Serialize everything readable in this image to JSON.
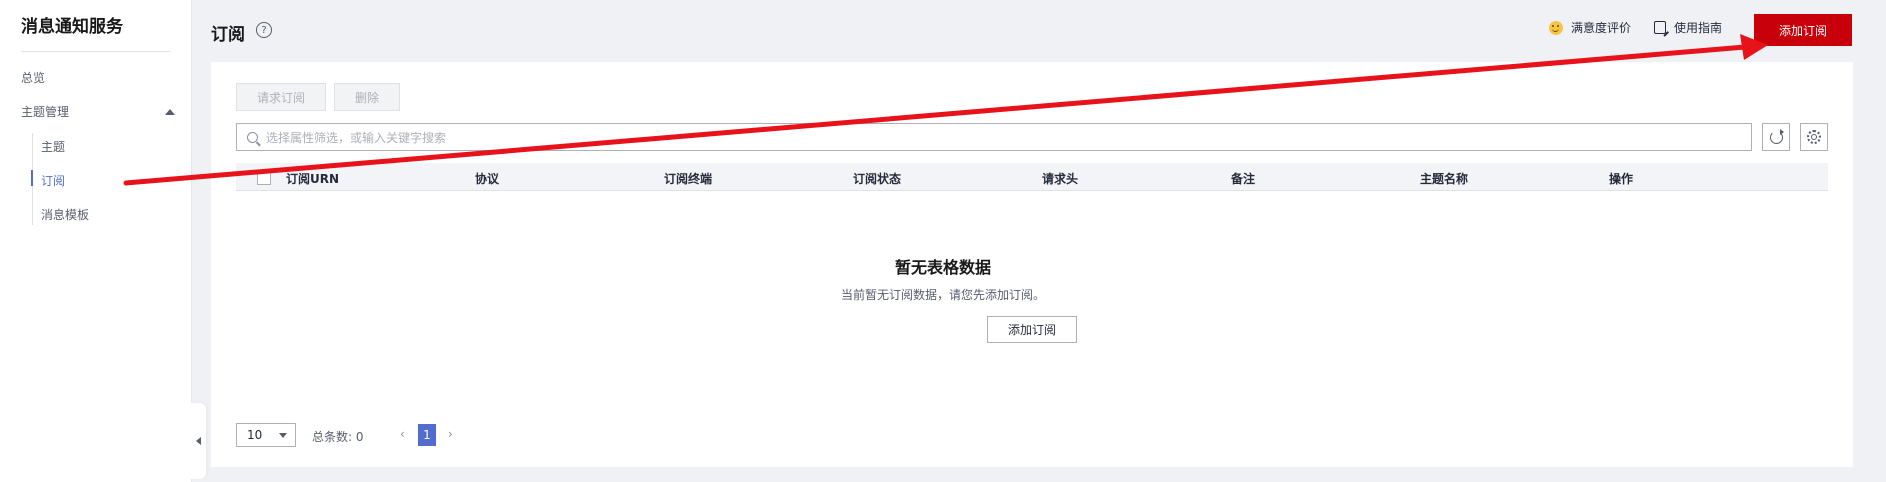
{
  "sidebar": {
    "title": "消息通知服务",
    "overview": "总览",
    "topic_mgmt": "主题管理",
    "sub_items": [
      "主题",
      "订阅",
      "消息模板"
    ]
  },
  "header": {
    "title": "订阅",
    "help": "?",
    "satisfaction": "满意度评价",
    "guide": "使用指南",
    "add_button": "添加订阅"
  },
  "toolbar": {
    "request_sub": "请求订阅",
    "delete": "删除",
    "search_placeholder": "选择属性筛选，或输入关键字搜索"
  },
  "table": {
    "columns": [
      "订阅URN",
      "协议",
      "订阅终端",
      "订阅状态",
      "请求头",
      "备注",
      "主题名称",
      "操作"
    ],
    "empty_title": "暂无表格数据",
    "empty_desc": "当前暂无订阅数据，请您先添加订阅。",
    "empty_add": "添加订阅"
  },
  "pagination": {
    "page_size": "10",
    "total": "总条数: 0",
    "current_page": "1",
    "prev": "‹",
    "next": "›"
  },
  "colors": {
    "primary": "#c7000b",
    "accent": "#526ecc",
    "annotation_arrow": "#e8131a"
  }
}
